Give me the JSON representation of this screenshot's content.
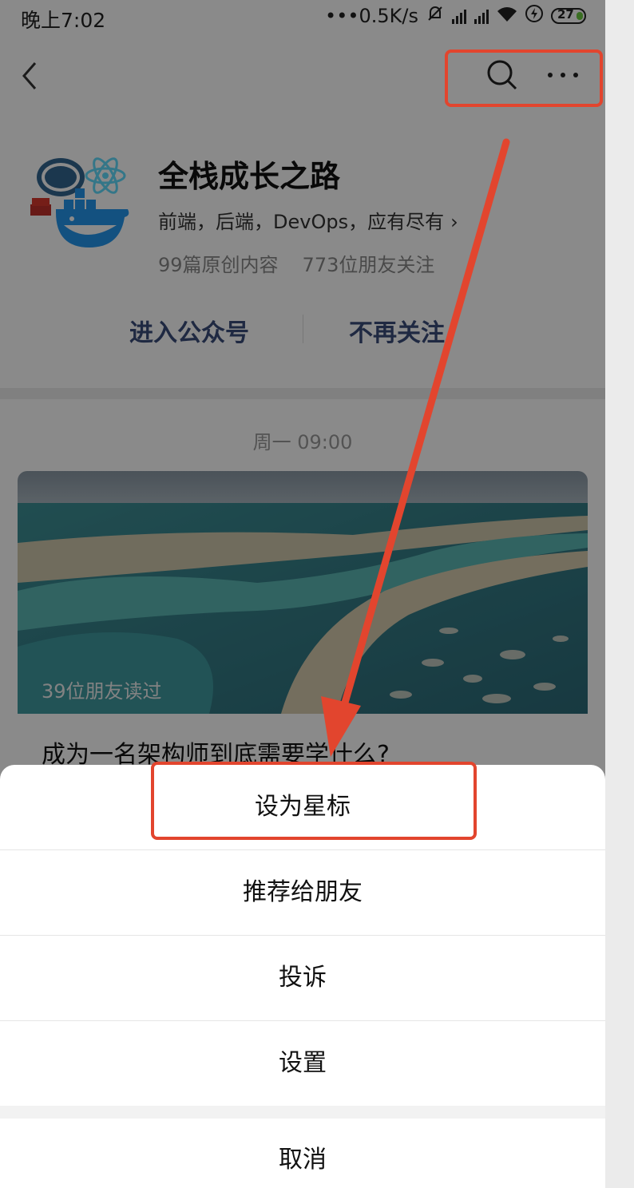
{
  "status_bar": {
    "time": "晚上7:02",
    "speed": "•••0.5K/s",
    "battery": "27"
  },
  "nav": {
    "back_icon": "chevron-left-icon",
    "search_icon": "search-icon",
    "more_icon": "more-icon"
  },
  "account": {
    "name": "全栈成长之路",
    "description": "前端，后端，DevOps，应有尽有",
    "articles": "99篇原创内容",
    "followers": "773位朋友关注",
    "enter_label": "进入公众号",
    "unfollow_label": "不再关注"
  },
  "feed": {
    "date": "周一 09:00",
    "card": {
      "readers": "39位朋友读过",
      "title": "成为一名架构师到底需要学什么?"
    }
  },
  "action_sheet": {
    "items": [
      "设为星标",
      "推荐给朋友",
      "投诉",
      "设置"
    ],
    "cancel": "取消"
  },
  "colors": {
    "annotation": "#e2452e",
    "action_text": "#3a4d7a",
    "battery_tip": "#6ccb3f"
  }
}
